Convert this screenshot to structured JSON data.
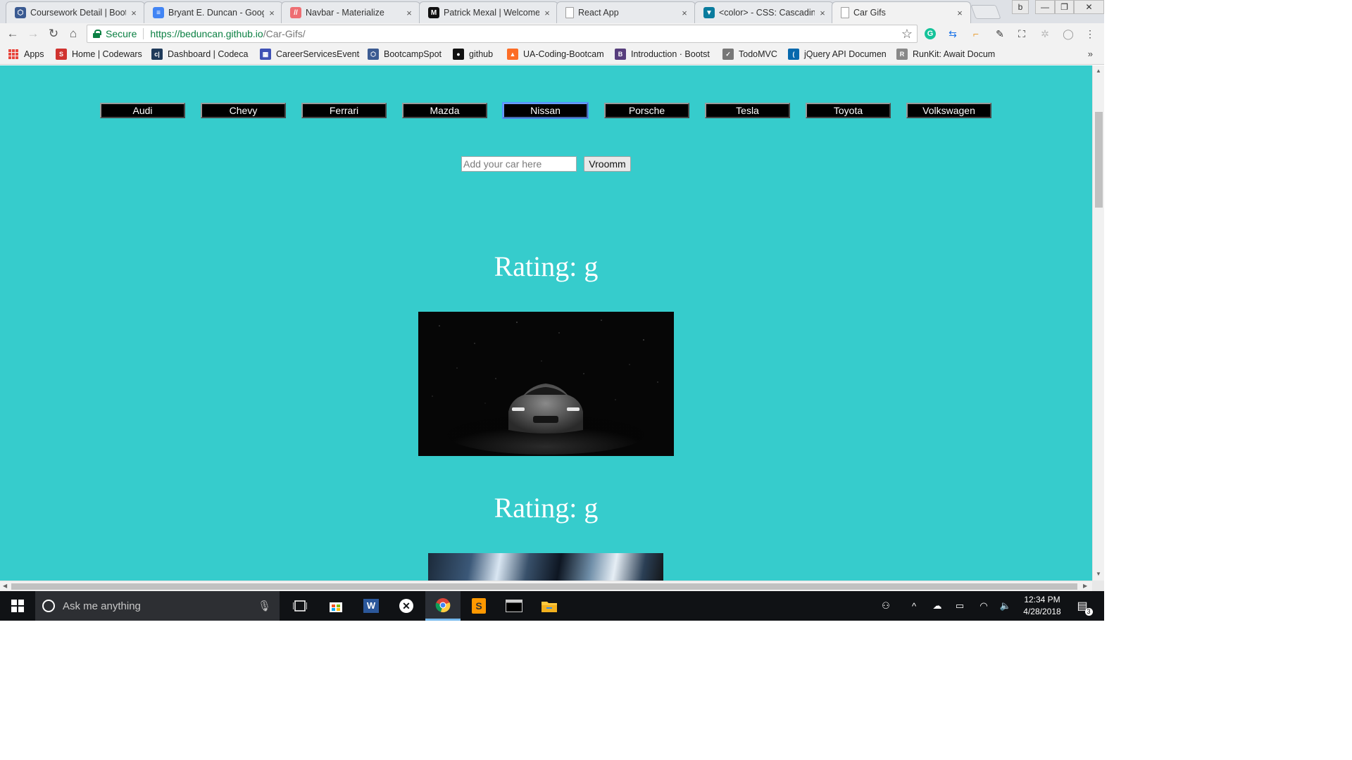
{
  "browser": {
    "tabs": [
      {
        "title": "Coursework Detail | Boot",
        "icon": "bootcampspot-icon",
        "color": "#3b5b92",
        "glyph": "⬡",
        "active": false
      },
      {
        "title": "Bryant E. Duncan - Goog",
        "icon": "google-docs-icon",
        "color": "#4285f4",
        "glyph": "≡",
        "active": false
      },
      {
        "title": "Navbar - Materialize",
        "icon": "materialize-icon",
        "color": "#ee6e73",
        "glyph": "//",
        "active": false
      },
      {
        "title": "Patrick Mexal | Welcome",
        "icon": "m-logo-icon",
        "color": "#111111",
        "glyph": "M",
        "active": false
      },
      {
        "title": "React App",
        "icon": "page-icon",
        "color": "#9e9e9e",
        "glyph": "",
        "active": false
      },
      {
        "title": "<color> - CSS: Cascading",
        "icon": "mdn-icon",
        "color": "#0a7c9e",
        "glyph": "▼",
        "active": false
      },
      {
        "title": "Car Gifs",
        "icon": "page-icon",
        "color": "#9e9e9e",
        "glyph": "",
        "active": true
      }
    ],
    "close_glyph": "×",
    "secure_label": "Secure",
    "url_host": "https://beduncan.github.io",
    "url_path": "/Car-Gifs/",
    "bookmarks": [
      {
        "label": "Apps",
        "icon": "apps-grid-icon",
        "color": "#e8453c",
        "glyph": ""
      },
      {
        "label": "Home | Codewars",
        "icon": "codewars-icon",
        "color": "#d0332f",
        "glyph": "S"
      },
      {
        "label": "Dashboard | Codeca",
        "icon": "codecademy-icon",
        "color": "#1f3a5a",
        "glyph": "c|"
      },
      {
        "label": "CareerServicesEvents",
        "icon": "calendar-icon",
        "color": "#3f51b5",
        "glyph": "▦"
      },
      {
        "label": "BootcampSpot",
        "icon": "bootcampspot-icon",
        "color": "#3b5b92",
        "glyph": "⬡"
      },
      {
        "label": "github",
        "icon": "github-icon",
        "color": "#111111",
        "glyph": "●"
      },
      {
        "label": "UA-Coding-Bootcam",
        "icon": "gitlab-icon",
        "color": "#fc6d26",
        "glyph": "▲"
      },
      {
        "label": "Introduction · Bootst",
        "icon": "bootstrap-icon",
        "color": "#563d7c",
        "glyph": "B"
      },
      {
        "label": "TodoMVC",
        "icon": "todomvc-icon",
        "color": "#777777",
        "glyph": "✓"
      },
      {
        "label": "jQuery API Documen",
        "icon": "jquery-icon",
        "color": "#0769ad",
        "glyph": "("
      },
      {
        "label": "RunKit: Await Docum",
        "icon": "runkit-icon",
        "color": "#888888",
        "glyph": "R"
      }
    ],
    "more_glyph": "»"
  },
  "page": {
    "car_buttons": [
      "Audi",
      "Chevy",
      "Ferrari",
      "Mazda",
      "Nissan",
      "Porsche",
      "Tesla",
      "Toyota",
      "Volkswagen"
    ],
    "focused_button": "Nissan",
    "input_placeholder": "Add your car here",
    "submit_label": "Vroomm",
    "results": [
      {
        "rating_label": "Rating: g"
      },
      {
        "rating_label": "Rating: g"
      }
    ]
  },
  "taskbar": {
    "search_placeholder": "Ask me anything",
    "time": "12:34 PM",
    "date": "4/28/2018",
    "notification_count": "3"
  },
  "colors": {
    "page_background": "#36cccc",
    "button_background": "#000000",
    "button_text": "#ffffff",
    "rating_text": "#ffffff"
  }
}
